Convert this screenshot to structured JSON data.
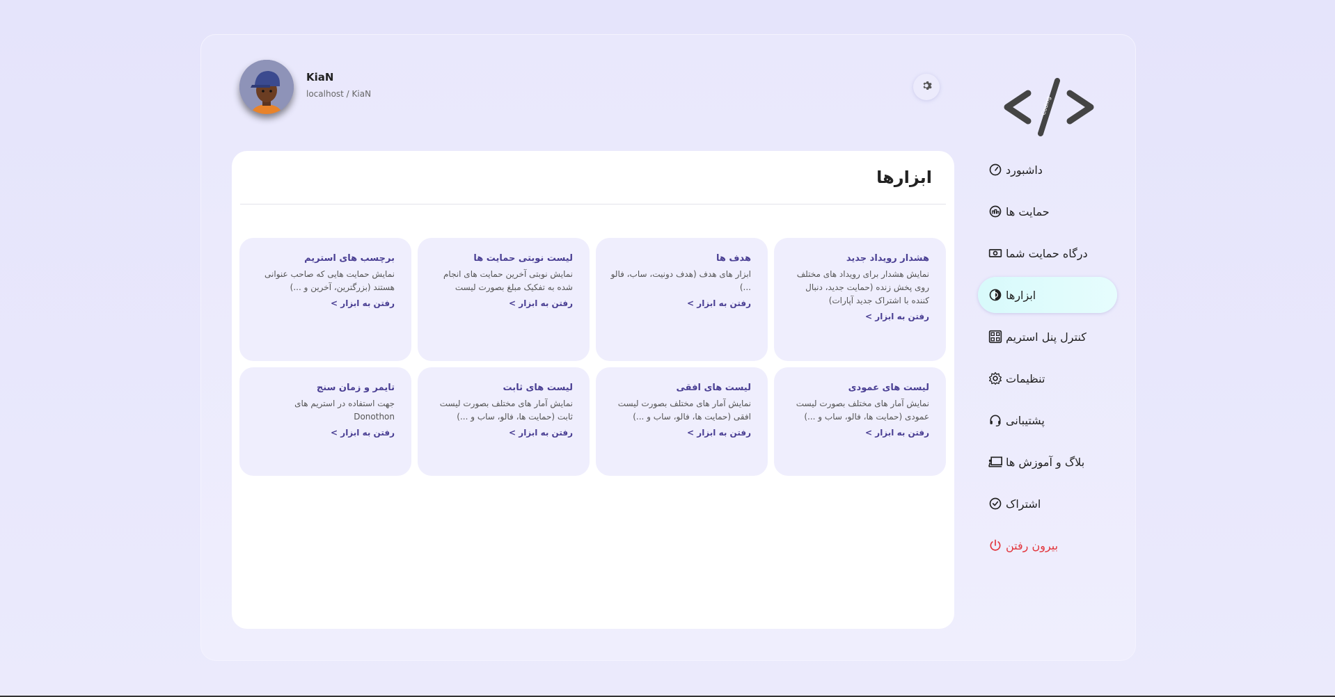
{
  "user": {
    "name": "KiaN",
    "path": "localhost / KiaN"
  },
  "logo": {
    "alt_text": "Coding"
  },
  "nav": {
    "items": [
      {
        "label": "داشبورد",
        "icon": "gauge-icon"
      },
      {
        "label": "حمایت ها",
        "icon": "donation-icon"
      },
      {
        "label": "درگاه حمایت شما",
        "icon": "cash-icon"
      },
      {
        "label": "ابزارها",
        "icon": "tools-icon",
        "active": true
      },
      {
        "label": "کنترل پنل استریم",
        "icon": "grid-icon"
      },
      {
        "label": "تنظیمات",
        "icon": "gear-icon"
      },
      {
        "label": "پشتیبانی",
        "icon": "headset-icon"
      },
      {
        "label": "بلاگ و آموزش ها",
        "icon": "blog-icon"
      },
      {
        "label": "اشتراک",
        "icon": "check-circle-icon"
      },
      {
        "label": "بیرون رفتن",
        "icon": "power-icon",
        "danger": true
      }
    ]
  },
  "main": {
    "title": "ابزارها",
    "link_label": "رفتن به ابزار >",
    "cards": [
      {
        "title": "هشدار رویداد جدید",
        "desc": "نمایش هشدار برای رویداد های مختلف روی پخش زنده (حمایت جدید، دنبال کننده با اشتراک جدید آپارات)"
      },
      {
        "title": "هدف ها",
        "desc": "ابزار های هدف (هدف دونیت، ساب، فالو ...)"
      },
      {
        "title": "لیست نوبتی حمایت ها",
        "desc": "نمایش نوبتی آخرین حمایت های انجام شده به تفکیک مبلغ بصورت لیست"
      },
      {
        "title": "برچسب های استریم",
        "desc": "نمایش حمایت هایی که صاحب عنوانی هستند (بزرگترین، آخرین و ...)"
      },
      {
        "title": "لیست های عمودی",
        "desc": "نمایش آمار های مختلف بصورت لیست عمودی (حمایت ها، فالو، ساب و ...)"
      },
      {
        "title": "لیست های افقی",
        "desc": "نمایش آمار های مختلف بصورت لیست افقی (حمایت ها، فالو، ساب و ...)"
      },
      {
        "title": "لیست های ثابت",
        "desc": "نمایش آمار های مختلف بصورت لیست ثابت (حمایت ها، فالو، ساب و ...)"
      },
      {
        "title": "تایمر و زمان سنج",
        "desc": "جهت استفاده در استریم های Donothon"
      }
    ]
  },
  "colors": {
    "accent": "#4a3f93",
    "active_bg": "#d8fafb",
    "danger": "#e2343b"
  }
}
